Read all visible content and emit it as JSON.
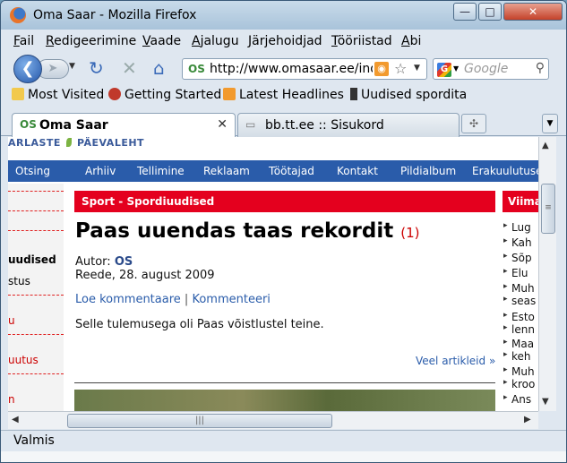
{
  "window": {
    "title": "Oma Saar - Mozilla Firefox",
    "controls": {
      "minimize": "—",
      "maximize": "□",
      "close": "✕"
    }
  },
  "menubar": {
    "items": [
      {
        "accel": "F",
        "rest": "ail"
      },
      {
        "accel": "R",
        "rest": "edigeerimine"
      },
      {
        "accel": "V",
        "rest": "aade"
      },
      {
        "accel": "A",
        "rest": "jalugu"
      },
      {
        "accel": "J",
        "rest": "ärjehoidjad"
      },
      {
        "accel": "T",
        "rest": "ööriistad"
      },
      {
        "accel": "A",
        "rest": "bi"
      }
    ]
  },
  "navbar": {
    "url": "http://www.omasaar.ee/index",
    "search_placeholder": "Google",
    "icons": [
      "back-icon",
      "forward-icon",
      "reload-icon",
      "stop-icon",
      "home-icon",
      "rss-icon",
      "bookmark-star-icon",
      "search-icon"
    ]
  },
  "bookmarks": {
    "items": [
      "Most Visited",
      "Getting Started",
      "Latest Headlines",
      "Uudised spordita"
    ]
  },
  "tabs": [
    {
      "label": "Oma Saar",
      "active": true
    },
    {
      "label": "bb.tt.ee :: Sisukord",
      "active": false
    }
  ],
  "page": {
    "logo_left": "ARLASTE",
    "logo_right": "PÄEVALEHT",
    "site_nav": [
      "Otsing",
      "Arhiiv",
      "Tellimine",
      "Reklaam",
      "Töötajad",
      "Kontakt",
      "Pildialbum",
      "Erakuulutuse"
    ],
    "left_col": [
      "",
      "",
      "",
      "uudised",
      "stus",
      "",
      "u",
      "",
      "uutus",
      "",
      "n"
    ],
    "section": "Sport - Spordiuudised",
    "headline": "Paas uuendas taas rekordit",
    "comment_count": "(1)",
    "author_label": "Autor:",
    "author": "OS",
    "date": "Reede, 28. august 2009",
    "link_read": "Loe kommentaare",
    "separator": "|",
    "link_comment": "Kommenteeri",
    "body": "Selle tulemusega oli Paas võistlustel teine.",
    "more": "Veel artikleid »",
    "right_head": "Viima",
    "right_items": [
      "Lug",
      "Kah",
      "Sõp",
      "Elu",
      "Muh",
      "seas",
      "Esto",
      "lenn",
      "Maa",
      "keh",
      "Muh",
      "kroo",
      "Ans"
    ]
  },
  "status": {
    "text": "Valmis"
  }
}
